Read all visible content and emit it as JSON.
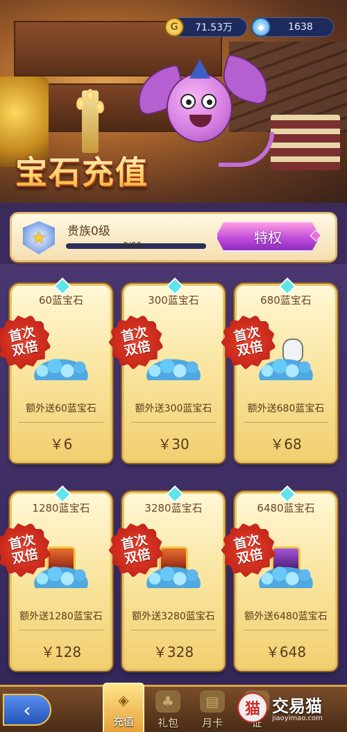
{
  "header": {
    "title": "宝石充值",
    "gold_amount": "71.53万",
    "gem_amount": "1638"
  },
  "vip": {
    "level_label": "贵族0级",
    "progress_text": "0/60",
    "progress_fraction": 0,
    "privilege_label": "特权"
  },
  "stamp_line1": "首次",
  "stamp_line2": "双倍",
  "cards": [
    {
      "gems": "60蓝宝石",
      "bonus": "额外送60蓝宝石",
      "price": "￥6",
      "art": "pile-small"
    },
    {
      "gems": "300蓝宝石",
      "bonus": "额外送300蓝宝石",
      "price": "￥30",
      "art": "pile-medium"
    },
    {
      "gems": "680蓝宝石",
      "bonus": "额外送680蓝宝石",
      "price": "￥68",
      "art": "pile-bag"
    },
    {
      "gems": "1280蓝宝石",
      "bonus": "额外送1280蓝宝石",
      "price": "￥128",
      "art": "chest-red"
    },
    {
      "gems": "3280蓝宝石",
      "bonus": "额外送3280蓝宝石",
      "price": "￥328",
      "art": "chest-red"
    },
    {
      "gems": "6480蓝宝石",
      "bonus": "额外送6480蓝宝石",
      "price": "￥648",
      "art": "chest-purple"
    }
  ],
  "nav": {
    "back_icon": "chevron-left-icon",
    "tabs": [
      {
        "label": "充值",
        "icon": "gem-shop-icon",
        "active": true
      },
      {
        "label": "礼包",
        "icon": "gift-bag-icon",
        "active": false
      },
      {
        "label": "月卡",
        "icon": "card-icon",
        "active": false
      },
      {
        "label": "证",
        "icon": "badge-icon",
        "active": false
      }
    ]
  },
  "watermark": {
    "name": "交易猫",
    "url": "jiaoyimao.com",
    "logo_mark": "猫"
  },
  "colors": {
    "card_gold": "#f1cf70",
    "stamp_red": "#c3261a",
    "privilege_purple": "#c24fdc",
    "panel_bg": "#34275a"
  }
}
